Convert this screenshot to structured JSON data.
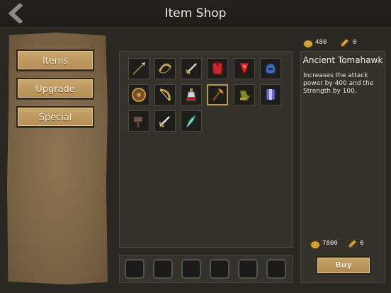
{
  "header": {
    "title": "Item Shop"
  },
  "nav": {
    "items": [
      "Items",
      "Upgrade",
      "Special"
    ]
  },
  "currency": {
    "gold": "480",
    "gems": "0"
  },
  "items": [
    {
      "icon": "spear-icon"
    },
    {
      "icon": "bow-icon"
    },
    {
      "icon": "dagger-icon"
    },
    {
      "icon": "red-armor-icon"
    },
    {
      "icon": "red-gem-amulet-icon"
    },
    {
      "icon": "blue-helmet-icon"
    },
    {
      "icon": "round-shield-icon"
    },
    {
      "icon": "curved-bow-icon"
    },
    {
      "icon": "potion-flask-icon"
    },
    {
      "icon": "tomahawk-icon"
    },
    {
      "icon": "green-gloves-icon"
    },
    {
      "icon": "blue-armor-icon"
    },
    {
      "icon": "war-hammer-icon"
    },
    {
      "icon": "sword-icon"
    },
    {
      "icon": "green-feather-icon"
    }
  ],
  "selected_index": 9,
  "detail": {
    "name": "Ancient Tomahawk",
    "description": "Increases the attack power by 400 and the Strength by 100.",
    "price_gold": "7800",
    "price_gems": "0",
    "buy_label": "Buy"
  },
  "colors": {
    "gold": "#e3b43d",
    "accent": "#c8a56c"
  }
}
